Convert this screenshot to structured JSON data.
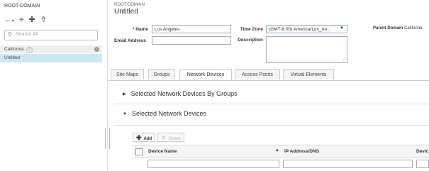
{
  "left_panel": {
    "title": "ROOT-DOMAIN",
    "search_placeholder": "Search All",
    "tree": [
      {
        "label": "California",
        "badge": "2"
      },
      {
        "label": "Untitled"
      }
    ]
  },
  "header": {
    "breadcrumb": "ROOT-DOMAIN",
    "title": "Untitled"
  },
  "form": {
    "name_label": "* Name",
    "name_value": "Los Angeles",
    "email_label": "Email Address",
    "email_value": "",
    "timezone_label": "Time Zone",
    "timezone_value": "(GMT-8:00) America/Los_An...",
    "description_label": "Description",
    "parent_domain_label": "Parent Domain",
    "parent_domain_value": "California"
  },
  "tabs": [
    "Site Maps",
    "Groups",
    "Network Devices",
    "Access Points",
    "Virtual Elements"
  ],
  "active_tab": "Network Devices",
  "sections": [
    {
      "label": "Selected Network Devices By Groups",
      "expanded": false
    },
    {
      "label": "Selected Network Devices",
      "expanded": true
    }
  ],
  "toolbar": {
    "add_label": "Add",
    "delete_label": "Delete"
  },
  "table": {
    "columns": [
      "Device Name",
      "IP Address/DNS",
      "Devic"
    ]
  }
}
